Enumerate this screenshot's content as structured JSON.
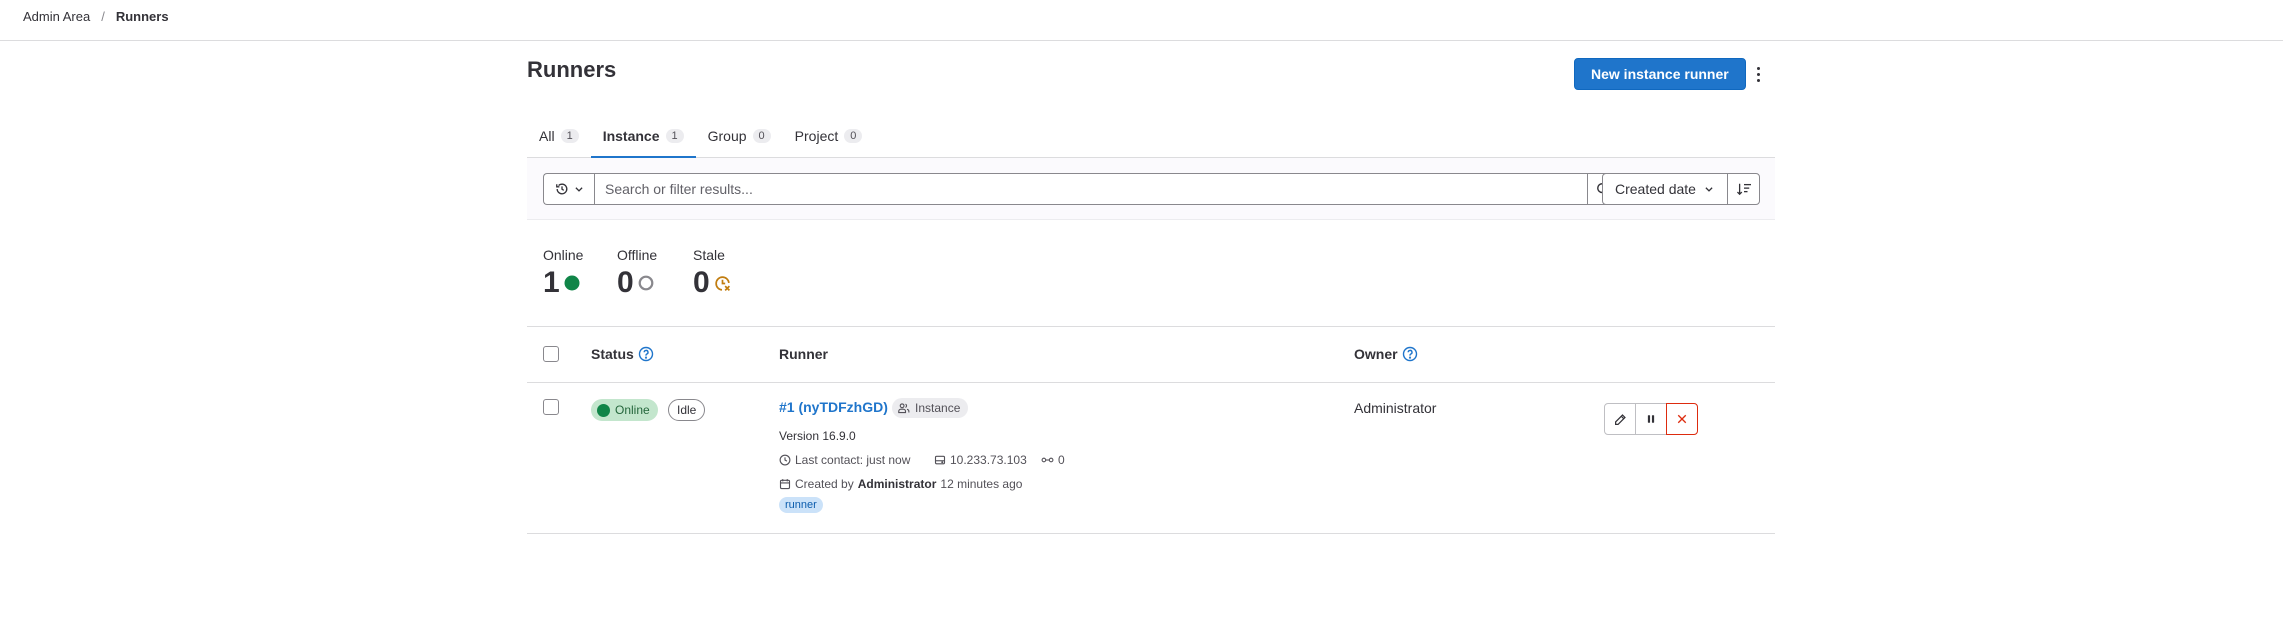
{
  "breadcrumb": {
    "parent": "Admin Area",
    "separator": "/",
    "current": "Runners"
  },
  "page": {
    "title": "Runners",
    "new_runner_label": "New instance runner"
  },
  "tabs": [
    {
      "label": "All",
      "count": "1"
    },
    {
      "label": "Instance",
      "count": "1"
    },
    {
      "label": "Group",
      "count": "0"
    },
    {
      "label": "Project",
      "count": "0"
    }
  ],
  "filter": {
    "placeholder": "Search or filter results...",
    "sort_label": "Created date"
  },
  "stats": [
    {
      "label": "Online",
      "value": "1"
    },
    {
      "label": "Offline",
      "value": "0"
    },
    {
      "label": "Stale",
      "value": "0"
    }
  ],
  "table": {
    "headers": {
      "status": "Status",
      "runner": "Runner",
      "owner": "Owner"
    },
    "row": {
      "status": "Online",
      "job_status": "Idle",
      "runner_name": "#1 (nyTDFzhGD)",
      "runner_type": "Instance",
      "version": "Version 16.9.0",
      "last_contact": "Last contact: just now",
      "ip": "10.233.73.103",
      "jobs": "0",
      "created_prefix": "Created by",
      "created_by": "Administrator",
      "created_when": "12 minutes ago",
      "tag": "runner",
      "owner": "Administrator"
    }
  },
  "colors": {
    "accent": "#1f75cb",
    "online": "#108548",
    "stale": "#c17d10",
    "danger": "#dd2b0e"
  }
}
